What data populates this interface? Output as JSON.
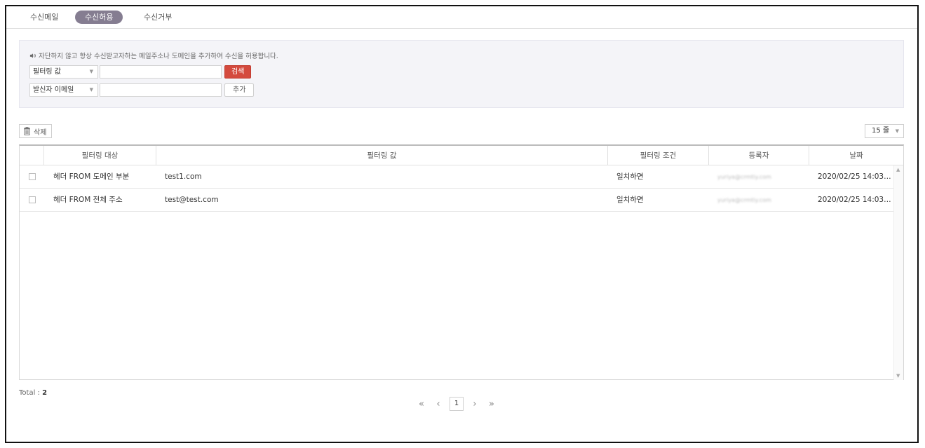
{
  "tabs": [
    {
      "label": "수신메일"
    },
    {
      "label": "수신허용"
    },
    {
      "label": "수신거부"
    }
  ],
  "search_panel": {
    "notice": "자단하지 않고 항상 수신받고자하는 메일주소나 도메인을 추가하여 수신을 허용합니다.",
    "filter_select": "필터링 값",
    "filter_input_value": "",
    "search_button": "검색",
    "sender_select": "발신자 이메일",
    "sender_input_value": "",
    "add_button": "추가"
  },
  "toolbar": {
    "delete_button": "삭제",
    "rows_per_page": "15 줄"
  },
  "table": {
    "headers": [
      "필터링 대상",
      "필터링 값",
      "필터링 조건",
      "등록자",
      "날짜"
    ],
    "rows": [
      {
        "target": "헤더 FROM 도메인 부분",
        "value": "test1.com",
        "condition": "일치하면",
        "registrant": "yuriya@crmtiy.com",
        "date": "2020/02/25 14:03:..."
      },
      {
        "target": "헤더 FROM 전체 주소",
        "value": "test@test.com",
        "condition": "일치하면",
        "registrant": "yuriya@crmtiy.com",
        "date": "2020/02/25 14:03:..."
      }
    ]
  },
  "footer": {
    "total_label": "Total : ",
    "total_count": "2",
    "current_page": "1"
  },
  "icons": {
    "first_page": "first-page-icon",
    "prev_page": "prev-page-icon",
    "next_page": "next-page-icon",
    "last_page": "last-page-icon",
    "speaker": "speaker-icon",
    "trash": "trash-icon"
  },
  "colors": {
    "active_tab": "#857d91",
    "search_button": "#d44a3e",
    "panel_bg": "#f4f4f8"
  }
}
